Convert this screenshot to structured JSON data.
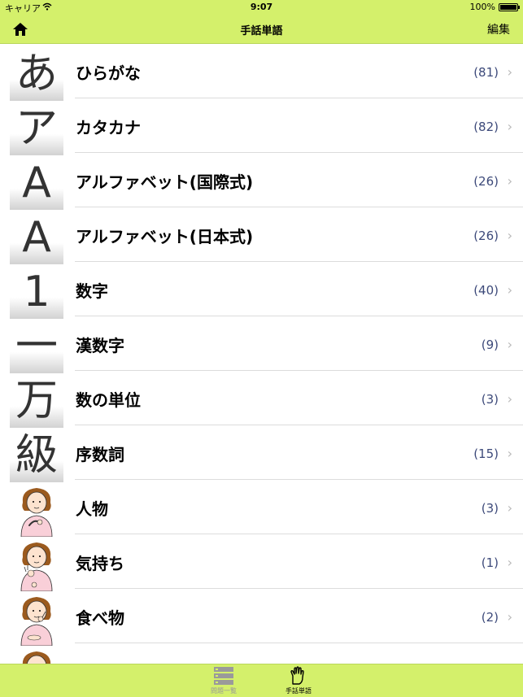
{
  "status": {
    "carrier": "キャリア",
    "time": "9:07",
    "battery": "100%"
  },
  "nav": {
    "title": "手話単語",
    "edit": "編集"
  },
  "rows": [
    {
      "thumb": "あ",
      "label": "ひらがな",
      "count": "(81)"
    },
    {
      "thumb": "ア",
      "label": "カタカナ",
      "count": "(82)"
    },
    {
      "thumb": "A",
      "label": "アルファベット(国際式)",
      "count": "(26)"
    },
    {
      "thumb": "A",
      "label": "アルファベット(日本式)",
      "count": "(26)"
    },
    {
      "thumb": "1",
      "label": "数字",
      "count": "(40)"
    },
    {
      "thumb": "一",
      "label": "漢数字",
      "count": "(9)"
    },
    {
      "thumb": "万",
      "label": "数の単位",
      "count": "(3)"
    },
    {
      "thumb": "級",
      "label": "序数詞",
      "count": "(15)"
    },
    {
      "thumb": "person-sign-illustration",
      "label": "人物",
      "count": "(3)"
    },
    {
      "thumb": "feelings-sign-illustration",
      "label": "気持ち",
      "count": "(1)"
    },
    {
      "thumb": "food-sign-illustration",
      "label": "食べ物",
      "count": "(2)"
    }
  ],
  "tabs": [
    {
      "label": "問題一覧",
      "icon": "list-icon",
      "active": false
    },
    {
      "label": "手話単語",
      "icon": "hand-sign-icon",
      "active": true
    }
  ],
  "colors": {
    "bar": "#d4f06b",
    "count": "#3d4a7a",
    "separator": "#dcdcdc"
  }
}
